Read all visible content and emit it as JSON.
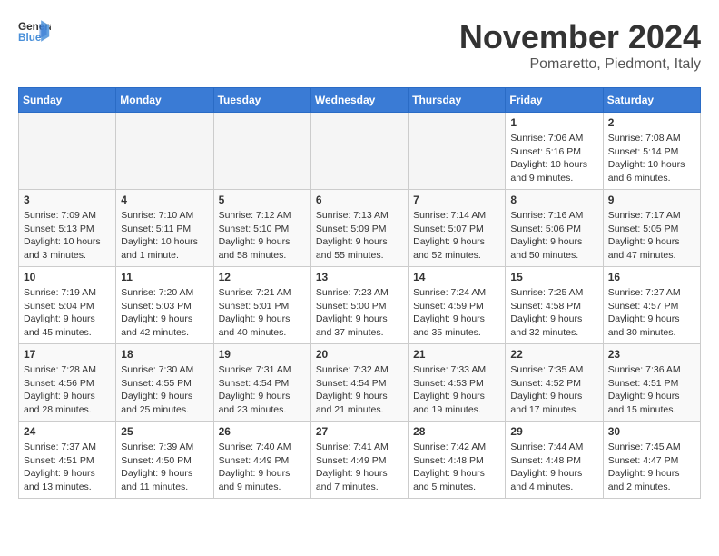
{
  "header": {
    "logo_line1": "General",
    "logo_line2": "Blue",
    "month": "November 2024",
    "location": "Pomaretto, Piedmont, Italy"
  },
  "weekdays": [
    "Sunday",
    "Monday",
    "Tuesday",
    "Wednesday",
    "Thursday",
    "Friday",
    "Saturday"
  ],
  "weeks": [
    [
      {
        "day": "",
        "info": ""
      },
      {
        "day": "",
        "info": ""
      },
      {
        "day": "",
        "info": ""
      },
      {
        "day": "",
        "info": ""
      },
      {
        "day": "",
        "info": ""
      },
      {
        "day": "1",
        "info": "Sunrise: 7:06 AM\nSunset: 5:16 PM\nDaylight: 10 hours\nand 9 minutes."
      },
      {
        "day": "2",
        "info": "Sunrise: 7:08 AM\nSunset: 5:14 PM\nDaylight: 10 hours\nand 6 minutes."
      }
    ],
    [
      {
        "day": "3",
        "info": "Sunrise: 7:09 AM\nSunset: 5:13 PM\nDaylight: 10 hours\nand 3 minutes."
      },
      {
        "day": "4",
        "info": "Sunrise: 7:10 AM\nSunset: 5:11 PM\nDaylight: 10 hours\nand 1 minute."
      },
      {
        "day": "5",
        "info": "Sunrise: 7:12 AM\nSunset: 5:10 PM\nDaylight: 9 hours\nand 58 minutes."
      },
      {
        "day": "6",
        "info": "Sunrise: 7:13 AM\nSunset: 5:09 PM\nDaylight: 9 hours\nand 55 minutes."
      },
      {
        "day": "7",
        "info": "Sunrise: 7:14 AM\nSunset: 5:07 PM\nDaylight: 9 hours\nand 52 minutes."
      },
      {
        "day": "8",
        "info": "Sunrise: 7:16 AM\nSunset: 5:06 PM\nDaylight: 9 hours\nand 50 minutes."
      },
      {
        "day": "9",
        "info": "Sunrise: 7:17 AM\nSunset: 5:05 PM\nDaylight: 9 hours\nand 47 minutes."
      }
    ],
    [
      {
        "day": "10",
        "info": "Sunrise: 7:19 AM\nSunset: 5:04 PM\nDaylight: 9 hours\nand 45 minutes."
      },
      {
        "day": "11",
        "info": "Sunrise: 7:20 AM\nSunset: 5:03 PM\nDaylight: 9 hours\nand 42 minutes."
      },
      {
        "day": "12",
        "info": "Sunrise: 7:21 AM\nSunset: 5:01 PM\nDaylight: 9 hours\nand 40 minutes."
      },
      {
        "day": "13",
        "info": "Sunrise: 7:23 AM\nSunset: 5:00 PM\nDaylight: 9 hours\nand 37 minutes."
      },
      {
        "day": "14",
        "info": "Sunrise: 7:24 AM\nSunset: 4:59 PM\nDaylight: 9 hours\nand 35 minutes."
      },
      {
        "day": "15",
        "info": "Sunrise: 7:25 AM\nSunset: 4:58 PM\nDaylight: 9 hours\nand 32 minutes."
      },
      {
        "day": "16",
        "info": "Sunrise: 7:27 AM\nSunset: 4:57 PM\nDaylight: 9 hours\nand 30 minutes."
      }
    ],
    [
      {
        "day": "17",
        "info": "Sunrise: 7:28 AM\nSunset: 4:56 PM\nDaylight: 9 hours\nand 28 minutes."
      },
      {
        "day": "18",
        "info": "Sunrise: 7:30 AM\nSunset: 4:55 PM\nDaylight: 9 hours\nand 25 minutes."
      },
      {
        "day": "19",
        "info": "Sunrise: 7:31 AM\nSunset: 4:54 PM\nDaylight: 9 hours\nand 23 minutes."
      },
      {
        "day": "20",
        "info": "Sunrise: 7:32 AM\nSunset: 4:54 PM\nDaylight: 9 hours\nand 21 minutes."
      },
      {
        "day": "21",
        "info": "Sunrise: 7:33 AM\nSunset: 4:53 PM\nDaylight: 9 hours\nand 19 minutes."
      },
      {
        "day": "22",
        "info": "Sunrise: 7:35 AM\nSunset: 4:52 PM\nDaylight: 9 hours\nand 17 minutes."
      },
      {
        "day": "23",
        "info": "Sunrise: 7:36 AM\nSunset: 4:51 PM\nDaylight: 9 hours\nand 15 minutes."
      }
    ],
    [
      {
        "day": "24",
        "info": "Sunrise: 7:37 AM\nSunset: 4:51 PM\nDaylight: 9 hours\nand 13 minutes."
      },
      {
        "day": "25",
        "info": "Sunrise: 7:39 AM\nSunset: 4:50 PM\nDaylight: 9 hours\nand 11 minutes."
      },
      {
        "day": "26",
        "info": "Sunrise: 7:40 AM\nSunset: 4:49 PM\nDaylight: 9 hours\nand 9 minutes."
      },
      {
        "day": "27",
        "info": "Sunrise: 7:41 AM\nSunset: 4:49 PM\nDaylight: 9 hours\nand 7 minutes."
      },
      {
        "day": "28",
        "info": "Sunrise: 7:42 AM\nSunset: 4:48 PM\nDaylight: 9 hours\nand 5 minutes."
      },
      {
        "day": "29",
        "info": "Sunrise: 7:44 AM\nSunset: 4:48 PM\nDaylight: 9 hours\nand 4 minutes."
      },
      {
        "day": "30",
        "info": "Sunrise: 7:45 AM\nSunset: 4:47 PM\nDaylight: 9 hours\nand 2 minutes."
      }
    ]
  ]
}
